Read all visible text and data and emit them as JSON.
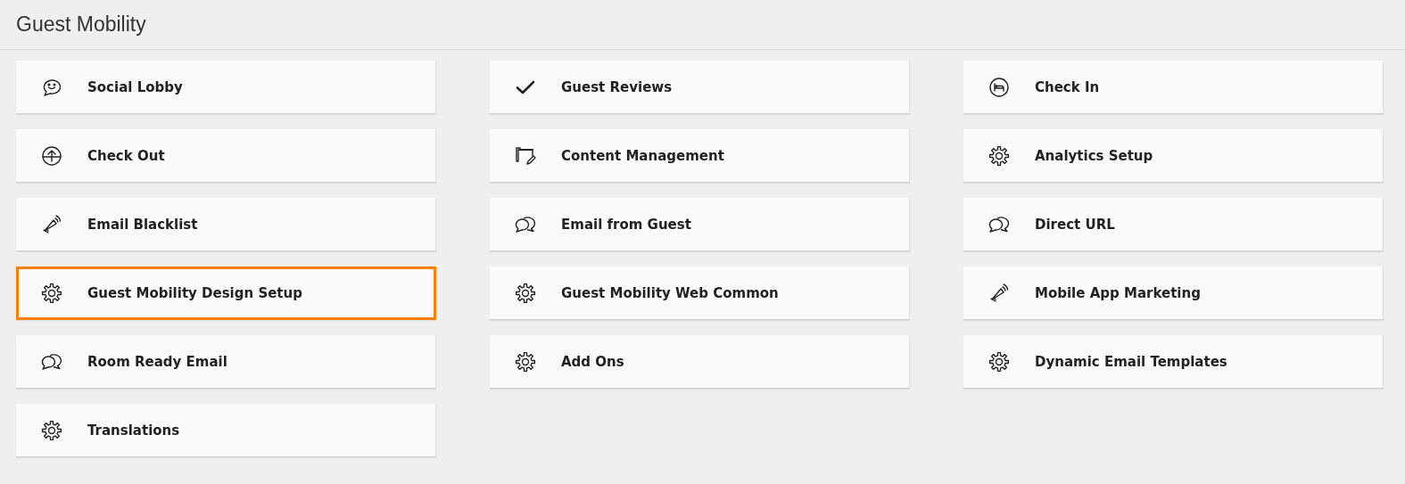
{
  "header": {
    "title": "Guest Mobility"
  },
  "tiles": [
    {
      "label": "Social Lobby",
      "kind": "smiley",
      "selected": false
    },
    {
      "label": "Guest Reviews",
      "kind": "check",
      "selected": false
    },
    {
      "label": "Check In",
      "kind": "bed",
      "selected": false
    },
    {
      "label": "Check Out",
      "kind": "upload",
      "selected": false
    },
    {
      "label": "Content Management",
      "kind": "folder",
      "selected": false
    },
    {
      "label": "Analytics Setup",
      "kind": "gear",
      "selected": false
    },
    {
      "label": "Email Blacklist",
      "kind": "megaphone",
      "selected": false
    },
    {
      "label": "Email from Guest",
      "kind": "chat",
      "selected": false
    },
    {
      "label": "Direct URL",
      "kind": "chat",
      "selected": false
    },
    {
      "label": "Guest Mobility Design Setup",
      "kind": "gear",
      "selected": true
    },
    {
      "label": "Guest Mobility Web Common",
      "kind": "gear",
      "selected": false
    },
    {
      "label": "Mobile App Marketing",
      "kind": "megaphone",
      "selected": false
    },
    {
      "label": "Room Ready Email",
      "kind": "chat",
      "selected": false
    },
    {
      "label": "Add Ons",
      "kind": "gear",
      "selected": false
    },
    {
      "label": "Dynamic Email Templates",
      "kind": "gear",
      "selected": false
    },
    {
      "label": "Translations",
      "kind": "gear",
      "selected": false
    }
  ]
}
